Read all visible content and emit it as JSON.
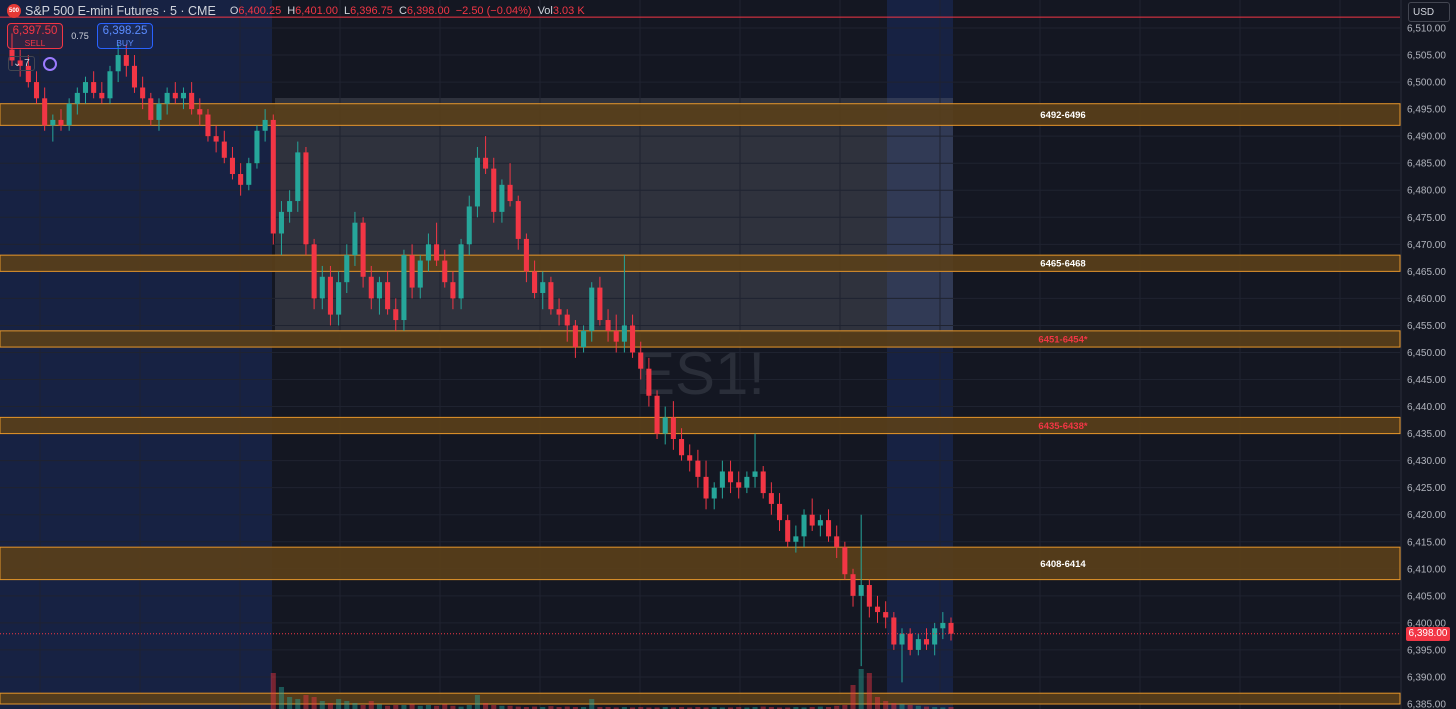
{
  "header": {
    "logo": "500",
    "symbol": "S&P 500 E-mini Futures · 5 · CME",
    "ohlc": [
      {
        "k": "O",
        "v": "6,400.25"
      },
      {
        "k": "H",
        "v": "6,401.00"
      },
      {
        "k": "L",
        "v": "6,396.75"
      },
      {
        "k": "C",
        "v": "6,398.00"
      }
    ],
    "change": "−2.50 (−0.04%)",
    "vol_label": "Vol",
    "vol_value": "3.03 K"
  },
  "trade": {
    "sell_price": "6,397.50",
    "sell_label": "SELL",
    "spread": "0.75",
    "buy_price": "6,398.25",
    "buy_label": "BUY"
  },
  "indicators": {
    "count": "7"
  },
  "currency": "USD",
  "watermark": "ES1!",
  "colors": {
    "background": "#141722",
    "up": "#26a69a",
    "down": "#f23645",
    "zone_fill": "#5a3f1a",
    "zone_border": "#e6962a"
  },
  "chart_data": {
    "type": "candlestick",
    "ylim": [
      6384,
      6512
    ],
    "y_ticks": [
      "6,510.00",
      "6,505.00",
      "6,500.00",
      "6,495.00",
      "6,490.00",
      "6,485.00",
      "6,480.00",
      "6,475.00",
      "6,470.00",
      "6,465.00",
      "6,460.00",
      "6,455.00",
      "6,450.00",
      "6,445.00",
      "6,440.00",
      "6,435.00",
      "6,430.00",
      "6,425.00",
      "6,420.00",
      "6,415.00",
      "6,410.00",
      "6,405.00",
      "6,400.00",
      "6,395.00",
      "6,390.00",
      "6,385.00"
    ],
    "y_tick_values": [
      6510,
      6505,
      6500,
      6495,
      6490,
      6485,
      6480,
      6475,
      6470,
      6465,
      6460,
      6455,
      6450,
      6445,
      6440,
      6435,
      6430,
      6425,
      6420,
      6415,
      6410,
      6405,
      6400,
      6395,
      6390,
      6385
    ],
    "last_price": 6398.0,
    "last_price_label": "6,398.00",
    "zones": [
      {
        "low": 6492,
        "high": 6496,
        "label": "6492-6496",
        "label_color": "#ffffff"
      },
      {
        "low": 6465,
        "high": 6468,
        "label": "6465-6468",
        "label_color": "#ffffff"
      },
      {
        "low": 6451,
        "high": 6454,
        "label": "6451-6454*",
        "label_color": "#f23645"
      },
      {
        "low": 6435,
        "high": 6438,
        "label": "6435-6438*",
        "label_color": "#f23645"
      },
      {
        "low": 6408,
        "high": 6414,
        "label": "6408-6414",
        "label_color": "#ffffff"
      },
      {
        "low": 6385,
        "high": 6387,
        "label": "",
        "label_color": "#ffffff"
      }
    ],
    "top_line": 6512,
    "candles": [
      [
        6506,
        6509,
        6503,
        6504
      ],
      [
        6504,
        6506,
        6501,
        6503
      ],
      [
        6503,
        6505,
        6499,
        6500
      ],
      [
        6500,
        6502,
        6496,
        6497
      ],
      [
        6497,
        6499,
        6491,
        6492
      ],
      [
        6492,
        6494,
        6489,
        6493
      ],
      [
        6493,
        6495,
        6491,
        6492
      ],
      [
        6492,
        6497,
        6491,
        6496
      ],
      [
        6496,
        6499,
        6494,
        6498
      ],
      [
        6498,
        6501,
        6496,
        6500
      ],
      [
        6500,
        6502,
        6497,
        6498
      ],
      [
        6498,
        6500,
        6496,
        6497
      ],
      [
        6497,
        6503,
        6496,
        6502
      ],
      [
        6502,
        6507,
        6500,
        6505
      ],
      [
        6505,
        6507,
        6501,
        6503
      ],
      [
        6503,
        6505,
        6498,
        6499
      ],
      [
        6499,
        6501,
        6495,
        6497
      ],
      [
        6497,
        6498,
        6492,
        6493
      ],
      [
        6493,
        6497,
        6491,
        6496
      ],
      [
        6496,
        6499,
        6494,
        6498
      ],
      [
        6498,
        6500,
        6496,
        6497
      ],
      [
        6497,
        6499,
        6495,
        6498
      ],
      [
        6498,
        6500,
        6494,
        6495
      ],
      [
        6495,
        6497,
        6492,
        6494
      ],
      [
        6494,
        6495,
        6489,
        6490
      ],
      [
        6490,
        6492,
        6487,
        6489
      ],
      [
        6489,
        6491,
        6485,
        6486
      ],
      [
        6486,
        6488,
        6482,
        6483
      ],
      [
        6483,
        6485,
        6479,
        6481
      ],
      [
        6481,
        6486,
        6480,
        6485
      ],
      [
        6485,
        6492,
        6484,
        6491
      ],
      [
        6491,
        6495,
        6489,
        6493
      ],
      [
        6493,
        6494,
        6470,
        6472
      ],
      [
        6472,
        6478,
        6468,
        6476
      ],
      [
        6476,
        6480,
        6474,
        6478
      ],
      [
        6478,
        6489,
        6476,
        6487
      ],
      [
        6487,
        6488,
        6468,
        6470
      ],
      [
        6470,
        6471,
        6458,
        6460
      ],
      [
        6460,
        6466,
        6458,
        6464
      ],
      [
        6464,
        6466,
        6455,
        6457
      ],
      [
        6457,
        6465,
        6455,
        6463
      ],
      [
        6463,
        6470,
        6461,
        6468
      ],
      [
        6468,
        6476,
        6466,
        6474
      ],
      [
        6474,
        6475,
        6462,
        6464
      ],
      [
        6464,
        6466,
        6458,
        6460
      ],
      [
        6460,
        6464,
        6457,
        6463
      ],
      [
        6463,
        6465,
        6457,
        6458
      ],
      [
        6458,
        6460,
        6454,
        6456
      ],
      [
        6456,
        6469,
        6454,
        6468
      ],
      [
        6468,
        6470,
        6460,
        6462
      ],
      [
        6462,
        6468,
        6460,
        6467
      ],
      [
        6467,
        6472,
        6465,
        6470
      ],
      [
        6470,
        6474,
        6466,
        6467
      ],
      [
        6467,
        6469,
        6462,
        6463
      ],
      [
        6463,
        6465,
        6458,
        6460
      ],
      [
        6460,
        6471,
        6458,
        6470
      ],
      [
        6470,
        6479,
        6468,
        6477
      ],
      [
        6477,
        6488,
        6475,
        6486
      ],
      [
        6486,
        6490,
        6483,
        6484
      ],
      [
        6484,
        6486,
        6474,
        6476
      ],
      [
        6476,
        6482,
        6474,
        6481
      ],
      [
        6481,
        6485,
        6477,
        6478
      ],
      [
        6478,
        6479,
        6469,
        6471
      ],
      [
        6471,
        6472,
        6463,
        6465
      ],
      [
        6465,
        6467,
        6460,
        6461
      ],
      [
        6461,
        6465,
        6458,
        6463
      ],
      [
        6463,
        6464,
        6457,
        6458
      ],
      [
        6458,
        6460,
        6455,
        6457
      ],
      [
        6457,
        6458,
        6452,
        6455
      ],
      [
        6455,
        6456,
        6449,
        6451
      ],
      [
        6451,
        6455,
        6450,
        6454
      ],
      [
        6454,
        6463,
        6452,
        6462
      ],
      [
        6462,
        6464,
        6455,
        6456
      ],
      [
        6456,
        6458,
        6452,
        6454
      ],
      [
        6454,
        6457,
        6450,
        6452
      ],
      [
        6452,
        6468,
        6450,
        6455
      ],
      [
        6455,
        6457,
        6449,
        6450
      ],
      [
        6450,
        6452,
        6445,
        6447
      ],
      [
        6447,
        6449,
        6440,
        6442
      ],
      [
        6442,
        6443,
        6434,
        6435
      ],
      [
        6435,
        6440,
        6433,
        6438
      ],
      [
        6438,
        6441,
        6432,
        6434
      ],
      [
        6434,
        6436,
        6430,
        6431
      ],
      [
        6431,
        6433,
        6428,
        6430
      ],
      [
        6430,
        6432,
        6425,
        6427
      ],
      [
        6427,
        6430,
        6421,
        6423
      ],
      [
        6423,
        6426,
        6421,
        6425
      ],
      [
        6425,
        6430,
        6423,
        6428
      ],
      [
        6428,
        6430,
        6424,
        6426
      ],
      [
        6426,
        6428,
        6423,
        6425
      ],
      [
        6425,
        6428,
        6424,
        6427
      ],
      [
        6427,
        6435,
        6425,
        6428
      ],
      [
        6428,
        6429,
        6423,
        6424
      ],
      [
        6424,
        6426,
        6420,
        6422
      ],
      [
        6422,
        6424,
        6417,
        6419
      ],
      [
        6419,
        6420,
        6414,
        6415
      ],
      [
        6415,
        6418,
        6413,
        6416
      ],
      [
        6416,
        6421,
        6414,
        6420
      ],
      [
        6420,
        6423,
        6417,
        6418
      ],
      [
        6418,
        6420,
        6416,
        6419
      ],
      [
        6419,
        6421,
        6415,
        6416
      ],
      [
        6416,
        6418,
        6412,
        6414
      ],
      [
        6414,
        6415,
        6408,
        6409
      ],
      [
        6409,
        6410,
        6403,
        6405
      ],
      [
        6405,
        6420,
        6392,
        6407
      ],
      [
        6407,
        6408,
        6401,
        6403
      ],
      [
        6403,
        6405,
        6400,
        6402
      ],
      [
        6402,
        6404,
        6399,
        6401
      ],
      [
        6401,
        6402,
        6395,
        6396
      ],
      [
        6396,
        6399,
        6389,
        6398
      ],
      [
        6398,
        6399,
        6394,
        6395
      ],
      [
        6395,
        6398,
        6394,
        6397
      ],
      [
        6397,
        6399,
        6395,
        6396
      ],
      [
        6396,
        6400,
        6394,
        6399
      ],
      [
        6399,
        6402,
        6397,
        6400
      ],
      [
        6400,
        6401,
        6396.75,
        6398
      ]
    ],
    "volumes_relative": [
      0,
      0,
      0,
      0,
      0,
      0,
      0,
      0,
      0,
      0,
      0,
      0,
      0,
      0,
      0,
      0,
      0,
      0,
      0,
      0,
      0,
      0,
      0,
      0,
      0,
      0,
      0,
      0,
      0,
      0,
      0,
      0,
      0.9,
      0.55,
      0.3,
      0.25,
      0.35,
      0.3,
      0.2,
      0.15,
      0.25,
      0.2,
      0.15,
      0.1,
      0.2,
      0.12,
      0.08,
      0.1,
      0.1,
      0.12,
      0.08,
      0.1,
      0.08,
      0.12,
      0.08,
      0.06,
      0.1,
      0.35,
      0.15,
      0.1,
      0.08,
      0.08,
      0.06,
      0.05,
      0.06,
      0.05,
      0.07,
      0.05,
      0.06,
      0.05,
      0.05,
      0.25,
      0.05,
      0.05,
      0.04,
      0.05,
      0.04,
      0.05,
      0.04,
      0.04,
      0.05,
      0.04,
      0.05,
      0.04,
      0.05,
      0.04,
      0.05,
      0.04,
      0.04,
      0.05,
      0.04,
      0.05,
      0.06,
      0.05,
      0.04,
      0.04,
      0.05,
      0.04,
      0.05,
      0.06,
      0.05,
      0.08,
      0.1,
      0.6,
      1.0,
      0.9,
      0.3,
      0.2,
      0.15,
      0.12,
      0.1,
      0.08,
      0.06,
      0.05,
      0.04,
      0.05
    ]
  }
}
